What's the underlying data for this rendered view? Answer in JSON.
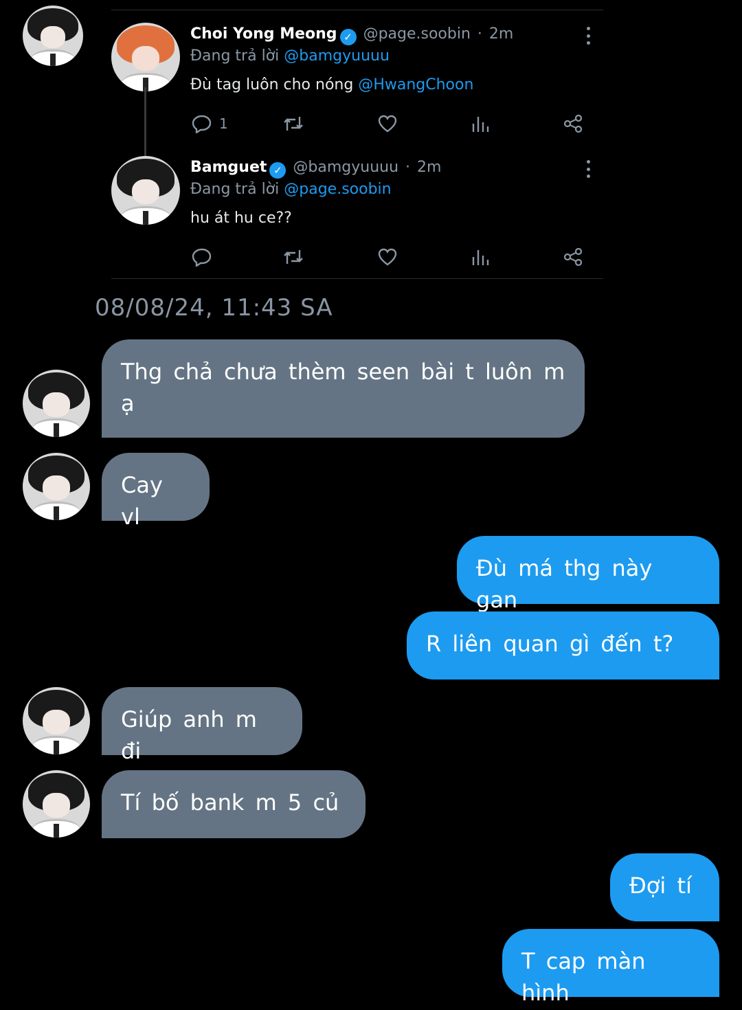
{
  "tweet_card": {
    "tweets": [
      {
        "name": "Choi Yong Meong",
        "handle": "@page.soobin",
        "time": "2m",
        "replying_prefix": "Đang trả lời",
        "replying_to": "@bamgyuuuu",
        "text": "Đù tag luôn cho nóng",
        "text_mention": "@HwangChoon",
        "reply_count": "1"
      },
      {
        "name": "Bamguet",
        "handle": "@bamgyuuuu",
        "time": "2m",
        "replying_prefix": "Đang trả lời",
        "replying_to": "@page.soobin",
        "text": "hu át hu ce??",
        "text_mention": "",
        "reply_count": ""
      }
    ]
  },
  "timestamp": "08/08/24, 11:43 SA",
  "messages": [
    {
      "direction": "in",
      "text": "Thg chả chưa thèm seen bài t luôn m ạ"
    },
    {
      "direction": "in",
      "text": "Cay vl"
    },
    {
      "direction": "out",
      "text": "Đù má thg này gan"
    },
    {
      "direction": "out",
      "text": "R liên quan gì đến t?"
    },
    {
      "direction": "in",
      "text": "Giúp anh m đi"
    },
    {
      "direction": "in",
      "text": "Tí bố bank m 5 củ"
    },
    {
      "direction": "out",
      "text": "Đợi tí"
    },
    {
      "direction": "out",
      "text": "T cap màn hình"
    }
  ],
  "colors": {
    "incoming_bubble": "#647484",
    "outgoing_bubble": "#1d9bf0",
    "mention": "#1d9bf0",
    "verified": "#1d9bf0"
  },
  "icons": [
    "verified-badge-icon",
    "more-options-icon",
    "reply-icon",
    "retweet-icon",
    "like-icon",
    "views-icon",
    "share-icon"
  ]
}
